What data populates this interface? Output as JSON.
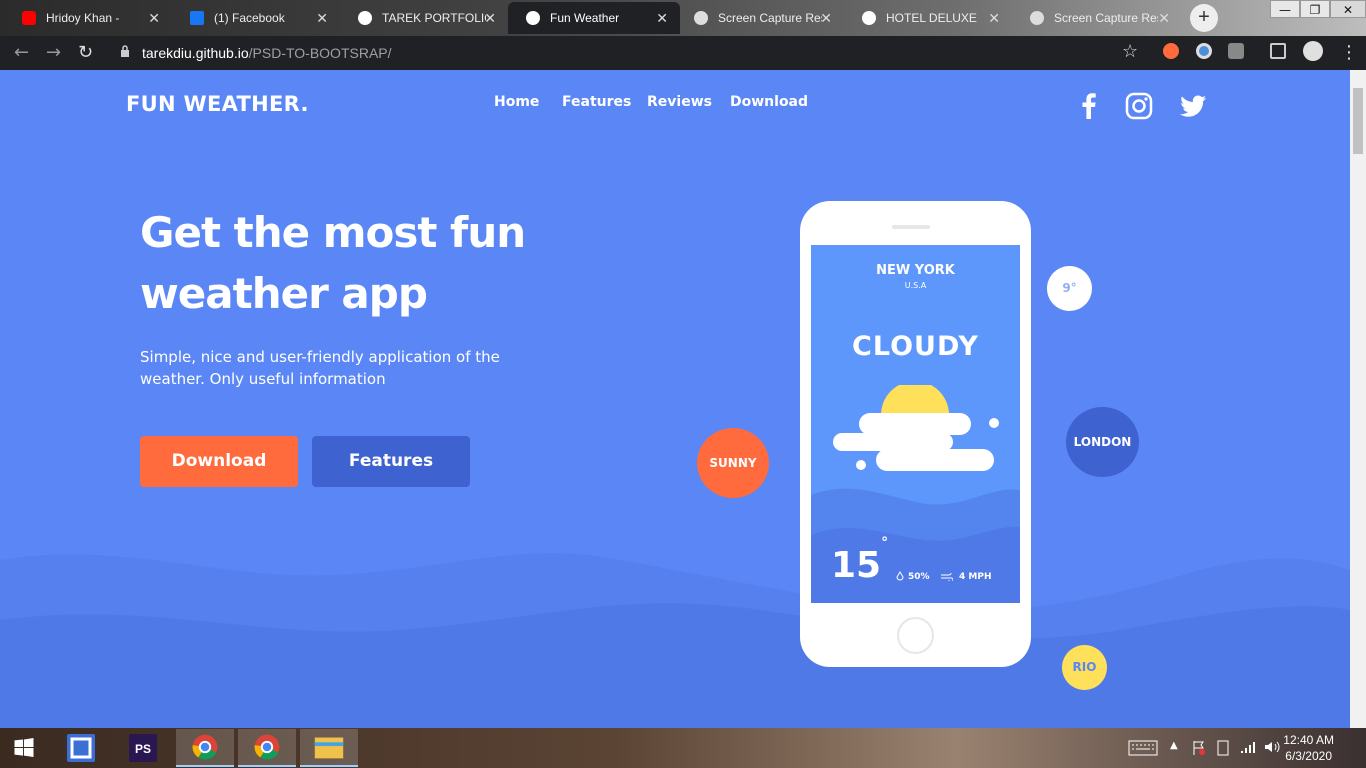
{
  "browser": {
    "tabs": [
      {
        "title": "Hridoy Khan - ",
        "favicon": "youtube-icon",
        "color": "#ff0000"
      },
      {
        "title": "(1) Facebook",
        "favicon": "facebook-icon",
        "color": "#1877f2"
      },
      {
        "title": "TAREK PORTFOLIO",
        "favicon": "globe-icon",
        "color": "#ffffff"
      },
      {
        "title": "Fun Weather",
        "favicon": "globe-icon",
        "color": "#ffffff"
      },
      {
        "title": "Screen Capture Res",
        "favicon": "capture-icon",
        "color": "#dddddd"
      },
      {
        "title": "HOTEL DELUXE",
        "favicon": "globe-icon",
        "color": "#ffffff"
      },
      {
        "title": "Screen Capture Res",
        "favicon": "capture-icon",
        "color": "#dddddd"
      }
    ],
    "active_tab": 3,
    "close_glyph": "✕",
    "new_tab_glyph": "+",
    "url_host": "tarekdiu.github.io",
    "url_path": "/PSD-TO-BOOTSRAP/",
    "window_controls": [
      "—",
      "❐",
      "✕"
    ],
    "toolbar": {
      "back": "←",
      "forward": "→",
      "reload": "↻",
      "star": "☆",
      "menu": "⋮"
    }
  },
  "site": {
    "logo": "FUN WEATHER.",
    "nav": [
      "Home",
      "Features",
      "Reviews",
      "Download"
    ],
    "headline": "Get the most fun weather app",
    "subtitle": "Simple, nice and user-friendly application of the weather. Only useful information",
    "download_label": "Download",
    "features_label": "Features",
    "colors": {
      "background": "#5b87f6",
      "download": "#ff6b3d",
      "features": "#3e62cf",
      "sunny": "#ff6b3d",
      "london": "#3e62cf",
      "rio": "#ffe05a"
    }
  },
  "phone": {
    "city": "NEW YORK",
    "country": "U.S.A",
    "condition": "CLOUDY",
    "temperature": "15",
    "degree": "°",
    "humidity": "50%",
    "wind": "4 MPH"
  },
  "bubbles": {
    "temp": "9°",
    "sunny": "SUNNY",
    "london": "LONDON",
    "rio": "RIO"
  },
  "taskbar": {
    "time": "12:40 AM",
    "date": "6/3/2020",
    "apps": [
      "windows-start",
      "brackets",
      "photoshop",
      "chrome",
      "chrome",
      "file-explorer"
    ]
  }
}
